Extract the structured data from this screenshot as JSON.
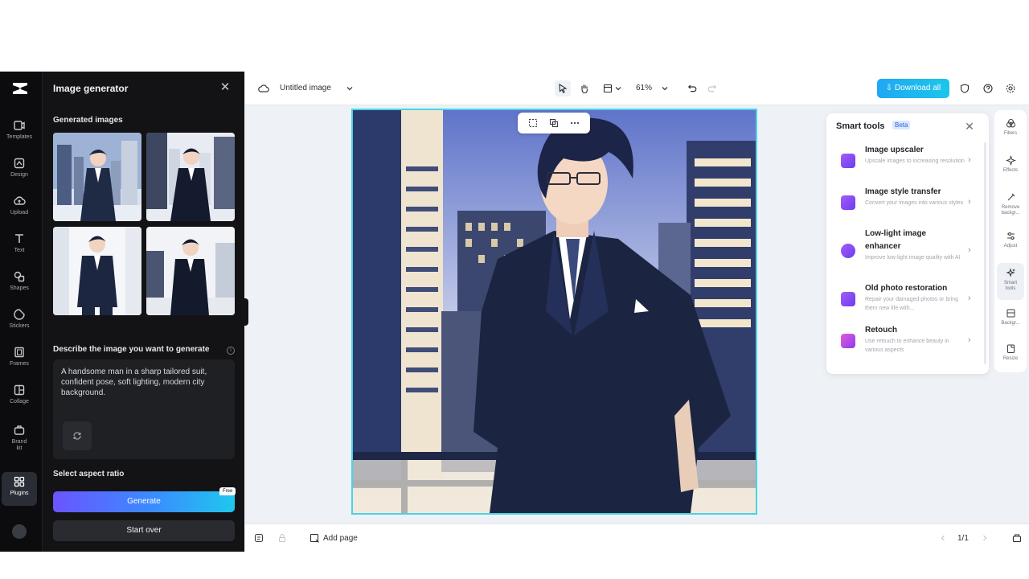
{
  "rail": {
    "items": [
      {
        "label": "Templates",
        "icon": "templates-icon"
      },
      {
        "label": "Design",
        "icon": "design-icon"
      },
      {
        "label": "Upload",
        "icon": "upload-icon"
      },
      {
        "label": "Text",
        "icon": "text-icon"
      },
      {
        "label": "Shapes",
        "icon": "shapes-icon"
      },
      {
        "label": "Stickers",
        "icon": "stickers-icon"
      },
      {
        "label": "Frames",
        "icon": "frames-icon"
      },
      {
        "label": "Collage",
        "icon": "collage-icon"
      },
      {
        "label": "Brand kit",
        "icon": "brand-kit-icon"
      },
      {
        "label": "Plugins",
        "icon": "plugins-icon",
        "active": true
      }
    ]
  },
  "panel": {
    "title": "Image generator",
    "generated_label": "Generated images",
    "describe_label": "Describe the image you want to generate",
    "prompt": "A handsome man in a sharp tailored suit, confident pose, soft lighting, modern city background.",
    "aspect_label": "Select aspect ratio",
    "generate_label": "Generate",
    "free_badge": "Free",
    "start_over_label": "Start over"
  },
  "topbar": {
    "doc_title": "Untitled image",
    "zoom": "61%",
    "download_label": "Download all"
  },
  "smart_tools": {
    "title": "Smart tools",
    "badge": "Beta",
    "tools": [
      {
        "name": "Image upscaler",
        "desc": "Upscale images to increasing resolution",
        "icon": "upscaler-icon"
      },
      {
        "name": "Image style transfer",
        "desc": "Convert your images into various styles",
        "icon": "style-transfer-icon"
      },
      {
        "name": "Low-light image enhancer",
        "desc": "Improve low-light image quality with AI",
        "icon": "low-light-icon"
      },
      {
        "name": "Old photo restoration",
        "desc": "Repair your damaged photos or bring them new life with...",
        "icon": "restoration-icon"
      },
      {
        "name": "Retouch",
        "desc": "Use retouch to enhance beauty in various aspects",
        "icon": "retouch-icon"
      }
    ]
  },
  "right_rail": {
    "items": [
      {
        "label": "Filters",
        "icon": "filters-icon"
      },
      {
        "label": "Effects",
        "icon": "effects-icon"
      },
      {
        "label": "Remove backgr...",
        "icon": "remove-background-icon"
      },
      {
        "label": "Adjust",
        "icon": "adjust-icon"
      },
      {
        "label": "Smart tools",
        "icon": "smart-tools-icon",
        "active": true
      },
      {
        "label": "Backgr...",
        "icon": "background-icon"
      },
      {
        "label": "Resize",
        "icon": "resize-icon"
      }
    ]
  },
  "bottombar": {
    "add_page_label": "Add page",
    "page_indicator": "1/1"
  },
  "colors": {
    "accent": "#1fb8ee",
    "selection": "#49d3e6",
    "generate_start": "#6a55ff",
    "generate_end": "#1fc8ee"
  }
}
